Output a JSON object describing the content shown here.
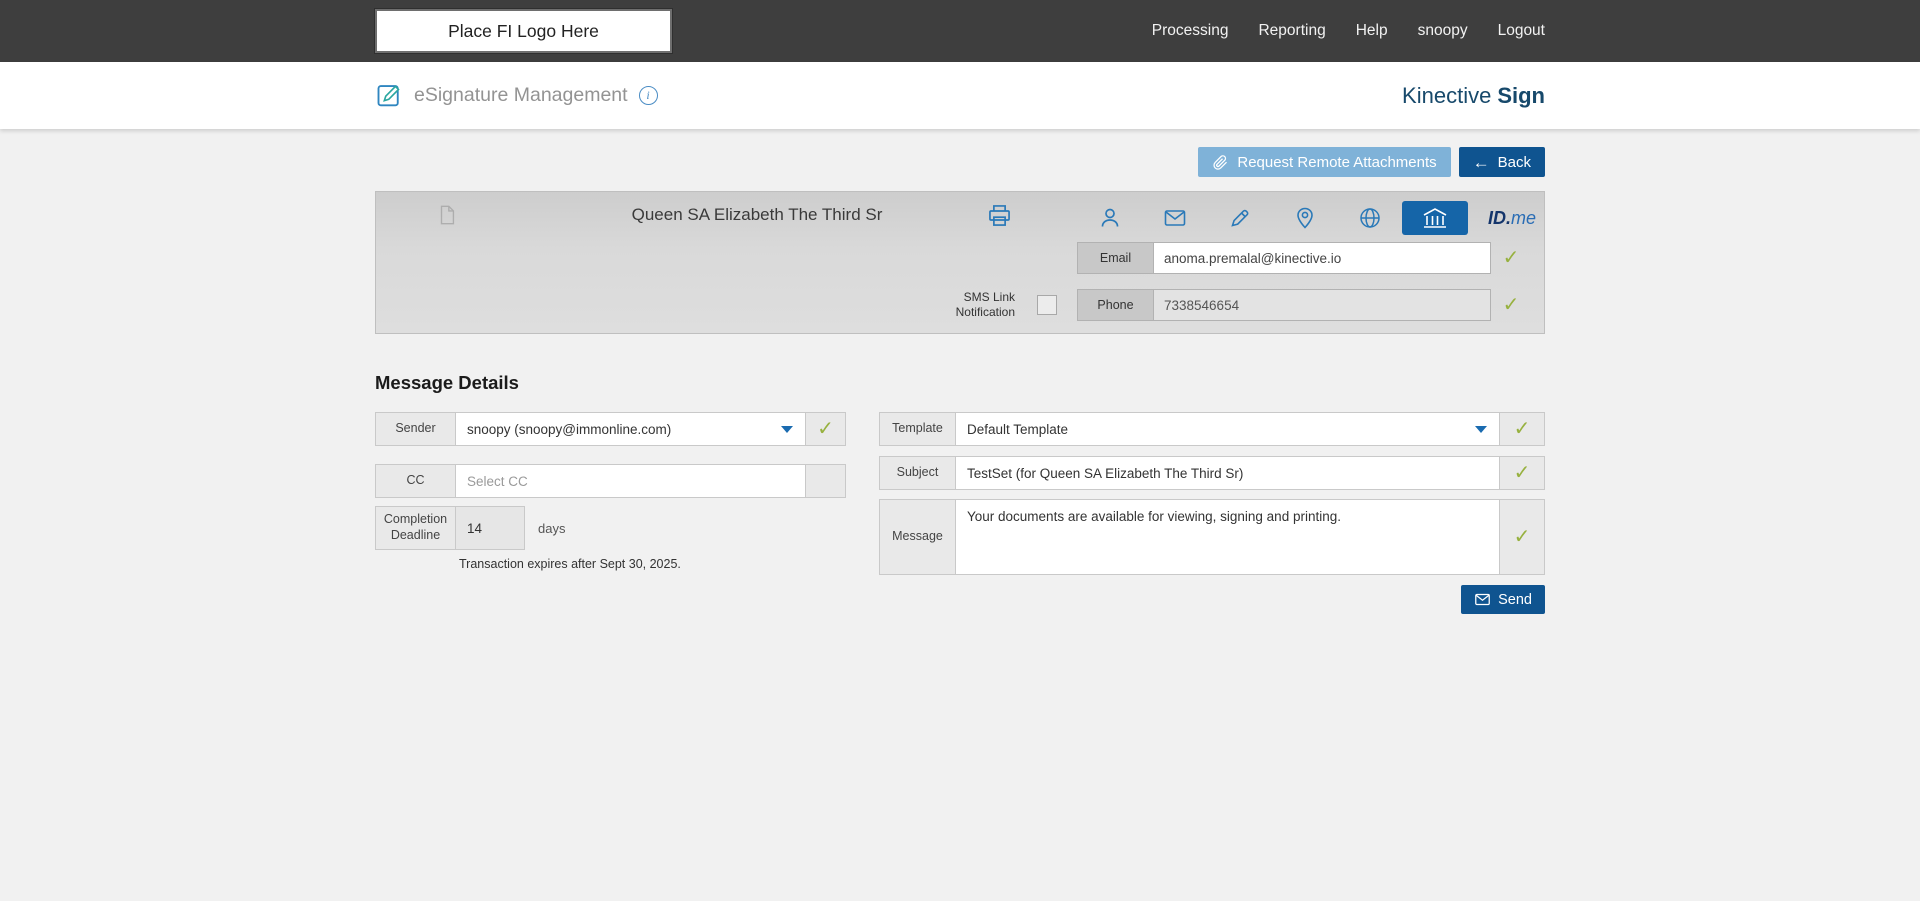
{
  "colors": {
    "topbar_bg": "#3e3e3e",
    "primary_blue": "#0f5490",
    "light_blue": "#7fb2d8",
    "icon_blue": "#2a79b8",
    "active_icon_bg": "#1565a8",
    "brand_navy": "#17496b",
    "check_green": "#97b13f",
    "panel_gray": "#d9d9d9"
  },
  "icons": {
    "back_arrow": "←",
    "check": "✓",
    "info": "i"
  },
  "topbar": {
    "logo_placeholder": "Place FI Logo Here",
    "nav": [
      {
        "label": "Processing"
      },
      {
        "label": "Reporting"
      },
      {
        "label": "Help"
      },
      {
        "label": "snoopy"
      },
      {
        "label": "Logout"
      }
    ]
  },
  "header": {
    "title": "eSignature Management",
    "brand_name": "Kinective",
    "brand_product": "Sign"
  },
  "toolbar": {
    "request_remote_attachments_label": "Request Remote Attachments",
    "back_label": "Back"
  },
  "recipient": {
    "name": "Queen SA Elizabeth The Third Sr",
    "email_label": "Email",
    "email_value": "anoma.premalal@kinective.io",
    "sms_label": "SMS Link Notification",
    "sms_checked": false,
    "phone_label": "Phone",
    "phone_value": "7338546654",
    "idme_part1": "ID.",
    "idme_part2": "me"
  },
  "message_details": {
    "heading": "Message Details",
    "sender_label": "Sender",
    "sender_value": "snoopy (snoopy@immonline.com)",
    "cc_label": "CC",
    "cc_placeholder": "Select CC",
    "deadline_label": "Completion Deadline",
    "deadline_value": "14",
    "deadline_unit": "days",
    "expiry_note": "Transaction expires after Sept 30, 2025.",
    "template_label": "Template",
    "template_value": "Default Template",
    "subject_label": "Subject",
    "subject_value": "TestSet (for Queen SA Elizabeth The Third Sr)",
    "message_label": "Message",
    "message_value": "Your documents are available for viewing, signing and printing.",
    "send_label": "Send"
  }
}
